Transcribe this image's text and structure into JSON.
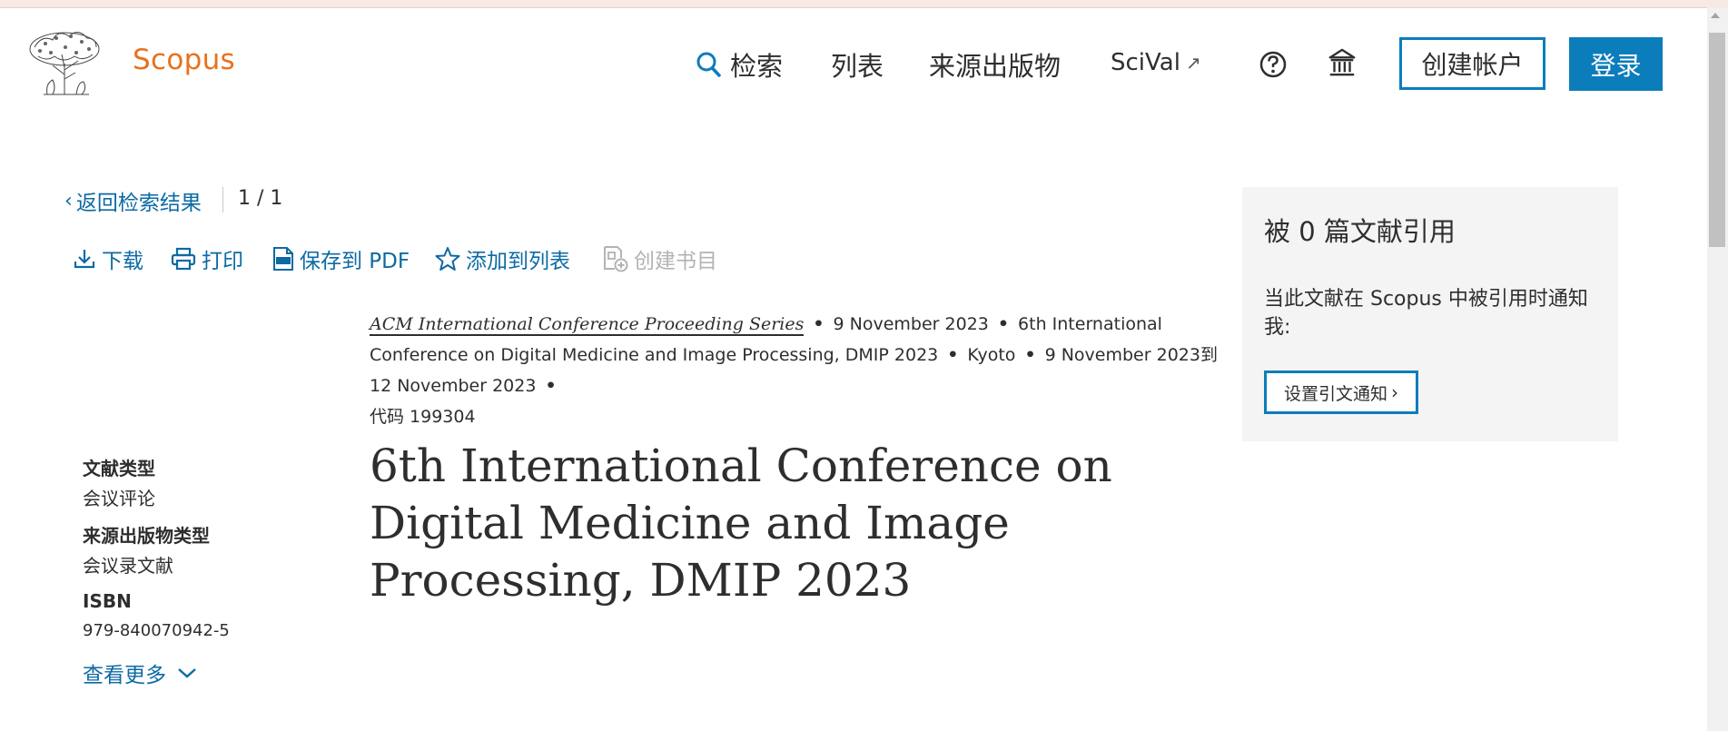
{
  "header": {
    "brand": "Scopus",
    "nav": {
      "search": "检索",
      "lists": "列表",
      "sources": "来源出版物",
      "scival": "SciVal",
      "scival_ext": "↗"
    },
    "create_account": "创建帐户",
    "login": "登录"
  },
  "toolbar": {
    "back": "返回检索结果",
    "back_chevron": "‹",
    "pager": "1 / 1",
    "download": "下载",
    "print": "打印",
    "save_pdf": "保存到 PDF",
    "add_list": "添加到列表",
    "create_bib": "创建书目"
  },
  "meta": {
    "series": "ACM International Conference Proceeding Series",
    "date": "9 November 2023",
    "conference": "6th International Conference on Digital Medicine and Image Processing, DMIP 2023",
    "location": "Kyoto",
    "dates_range": "9 November 2023到 12 November 2023",
    "code": "代码 199304",
    "dot": "•"
  },
  "info": {
    "doc_type_label": "文献类型",
    "doc_type_value": "会议评论",
    "source_type_label": "来源出版物类型",
    "source_type_value": "会议录文献",
    "isbn_label": "ISBN",
    "isbn_value": "979-840070942-5",
    "more": "查看更多"
  },
  "title": "6th International Conference on Digital Medicine and Image Processing, DMIP 2023",
  "citations": {
    "count_text": "被 0 篇文献引用",
    "description": "当此文献在 Scopus 中被引用时通知我:",
    "alert_button": "设置引文通知",
    "alert_chevron": "›"
  },
  "colors": {
    "brand_orange": "#e9711c",
    "link_blue": "#0c6aa4",
    "button_blue": "#0c7dbb"
  },
  "icons": [
    "elsevier-tree-logo",
    "search-icon",
    "help-icon",
    "institution-icon",
    "download-icon",
    "print-icon",
    "pdf-icon",
    "star-icon",
    "bibliography-icon",
    "chevron-down-icon"
  ]
}
